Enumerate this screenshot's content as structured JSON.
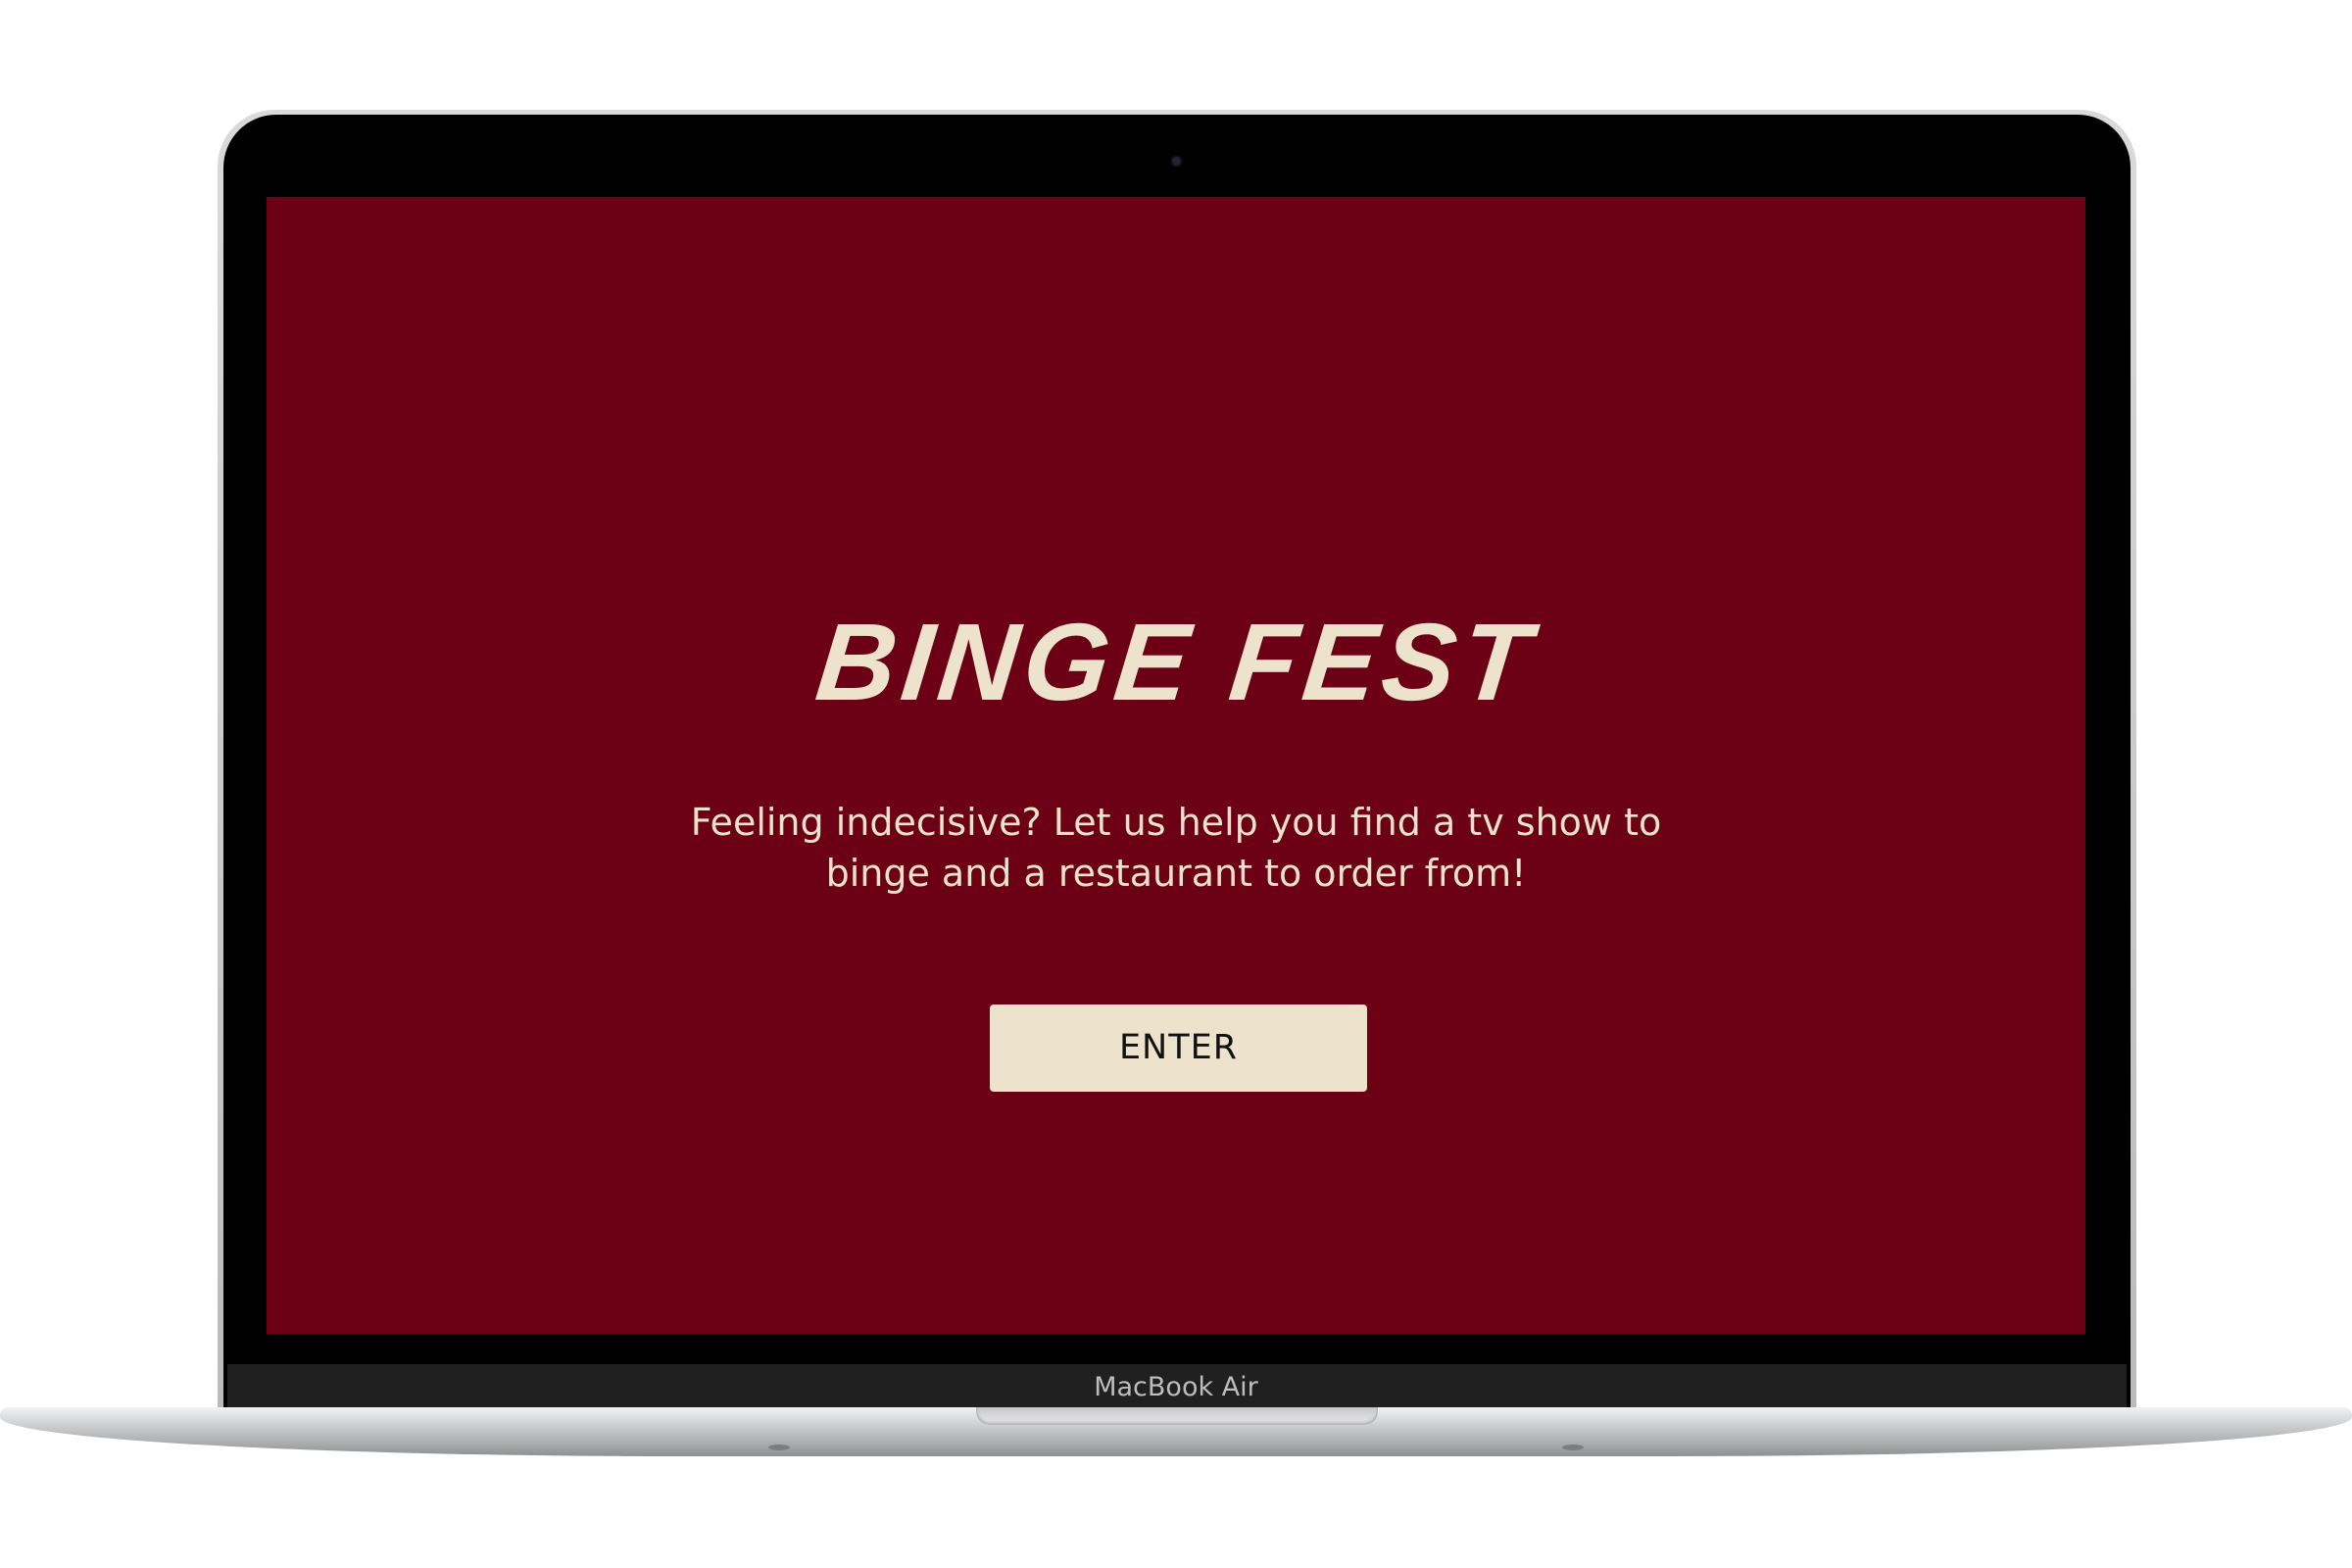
{
  "device": {
    "label": "MacBook Air"
  },
  "app": {
    "title": "BINGE FEST",
    "tagline": "Feeling indecisive? Let us help you find a tv show to binge and a restaurant to order from!",
    "enter_label": "ENTER"
  },
  "colors": {
    "background": "#6c0015",
    "text": "#ede3cc",
    "button_bg": "#ede3cc",
    "button_text": "#111111"
  }
}
